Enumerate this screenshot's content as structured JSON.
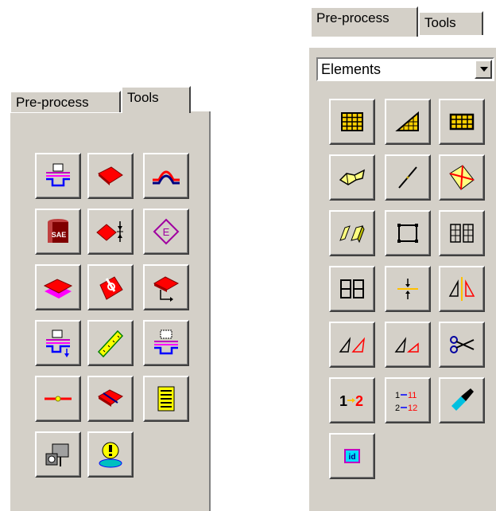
{
  "left_panel": {
    "tabs": [
      {
        "label": "Pre-process",
        "active": false
      },
      {
        "label": "Tools",
        "active": true
      }
    ],
    "buttons": [
      {
        "icon": "die-setup-icon"
      },
      {
        "icon": "red-sheet-icon"
      },
      {
        "icon": "bend-profile-icon"
      },
      {
        "icon": "sae-material-icon"
      },
      {
        "icon": "thickness-icon"
      },
      {
        "icon": "e-diamond-icon"
      },
      {
        "icon": "layer-stack-icon"
      },
      {
        "icon": "weld-pin-icon"
      },
      {
        "icon": "sheet-axis-icon"
      },
      {
        "icon": "die-move-icon"
      },
      {
        "icon": "ruler-icon"
      },
      {
        "icon": "die-gap-icon"
      },
      {
        "icon": "drawbead-line-icon"
      },
      {
        "icon": "cut-sheet-icon"
      },
      {
        "icon": "list-table-icon"
      },
      {
        "icon": "camera-icon"
      },
      {
        "icon": "alert-bulb-icon"
      }
    ]
  },
  "right_panel": {
    "tabs": [
      {
        "label": "Pre-process",
        "active": true
      },
      {
        "label": "Tools",
        "active": false
      }
    ],
    "select": {
      "value": "Elements"
    },
    "buttons": [
      {
        "icon": "mesh-icon"
      },
      {
        "icon": "triangle-mesh-icon"
      },
      {
        "icon": "grid-icon"
      },
      {
        "icon": "twisted-shape-icon"
      },
      {
        "icon": "line-element-icon"
      },
      {
        "icon": "check-elements-icon"
      },
      {
        "icon": "solid-elements-icon"
      },
      {
        "icon": "square-nodes-icon"
      },
      {
        "icon": "split-mesh-icon"
      },
      {
        "icon": "merge-mesh-icon"
      },
      {
        "icon": "move-node-icon"
      },
      {
        "icon": "mirror-icon"
      },
      {
        "icon": "triangle-pair-icon"
      },
      {
        "icon": "triangle-pair-small-icon"
      },
      {
        "icon": "scissors-icon"
      },
      {
        "icon": "renumber-icon"
      },
      {
        "icon": "renumber-offset-icon"
      },
      {
        "icon": "paint-brush-icon"
      },
      {
        "icon": "id-icon"
      }
    ]
  }
}
